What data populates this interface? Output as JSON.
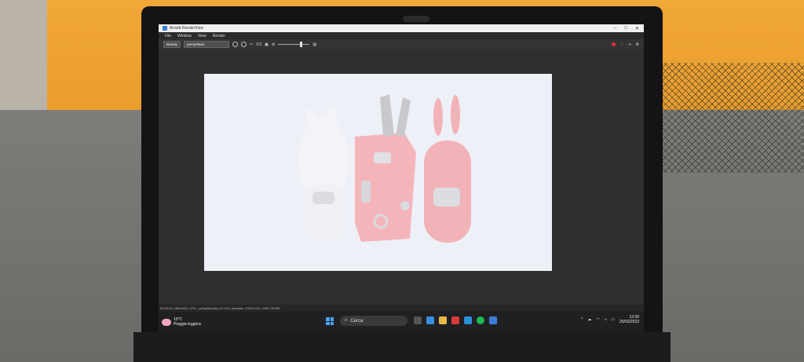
{
  "window": {
    "title": "Arnold RenderView",
    "controls": [
      "–",
      "□",
      "✕"
    ]
  },
  "menu": [
    "File",
    "Window",
    "View",
    "Render"
  ],
  "toolbar": {
    "camera_select": "Beauty",
    "aov_select": "persp/Main",
    "exposure_label": "0.0"
  },
  "statusbar": {
    "text": "00:00:00 | 960x540 | CPU : persp/Beauty (14.1%) | samples: 3/2/2/2/2/2 | 4957.95 MB"
  },
  "taskbar": {
    "weather_temp": "10°C",
    "weather_desc": "Pioggia leggera",
    "search_label": "Cerca",
    "time": "12:30",
    "date": "25/02/2023"
  },
  "colors": {
    "render_bg": "#eef0f7",
    "accent_blue": "#4aa3f0",
    "record_red": "#e03030",
    "rabbit_pink": "#f2b3b8",
    "wall_orange": "#f2a838"
  }
}
